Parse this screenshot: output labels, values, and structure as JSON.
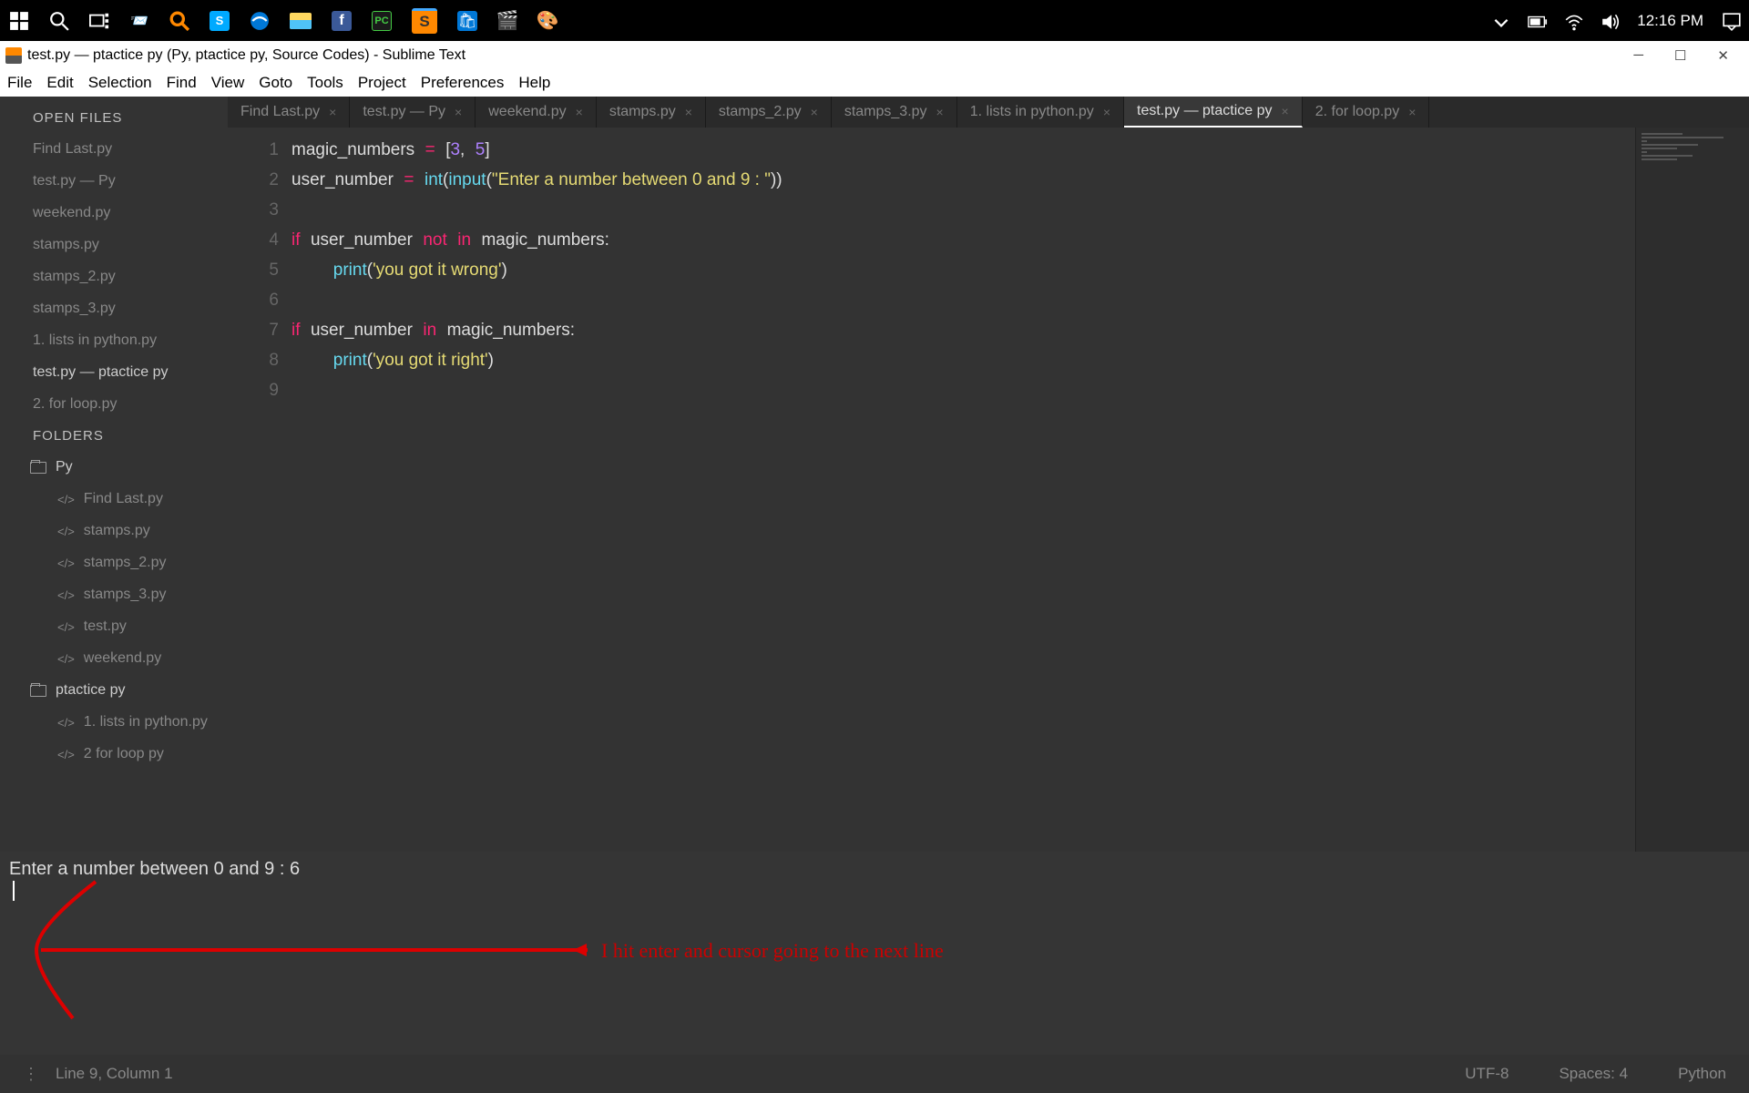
{
  "taskbar": {
    "time": "12:16 PM"
  },
  "titlebar": {
    "title": "test.py — ptactice py (Py, ptactice py, Source Codes) - Sublime Text"
  },
  "menubar": [
    "File",
    "Edit",
    "Selection",
    "Find",
    "View",
    "Goto",
    "Tools",
    "Project",
    "Preferences",
    "Help"
  ],
  "sidebar": {
    "open_files_label": "OPEN FILES",
    "open_files": [
      "Find Last.py",
      "test.py — Py",
      "weekend.py",
      "stamps.py",
      "stamps_2.py",
      "stamps_3.py",
      "1. lists in python.py",
      "test.py — ptactice py",
      "2. for loop.py"
    ],
    "folders_label": "FOLDERS",
    "folders": [
      {
        "name": "Py",
        "files": [
          "Find Last.py",
          "stamps.py",
          "stamps_2.py",
          "stamps_3.py",
          "test.py",
          "weekend.py"
        ]
      },
      {
        "name": "ptactice py",
        "files": [
          "1. lists in python.py",
          "2  for loop py"
        ]
      }
    ]
  },
  "tabs": [
    {
      "label": "Find Last.py",
      "active": false
    },
    {
      "label": "test.py — Py",
      "active": false
    },
    {
      "label": "weekend.py",
      "active": false
    },
    {
      "label": "stamps.py",
      "active": false
    },
    {
      "label": "stamps_2.py",
      "active": false
    },
    {
      "label": "stamps_3.py",
      "active": false
    },
    {
      "label": "1. lists in python.py",
      "active": false
    },
    {
      "label": "test.py — ptactice py",
      "active": true
    },
    {
      "label": "2. for loop.py",
      "active": false
    }
  ],
  "code": {
    "lines": [
      1,
      2,
      3,
      4,
      5,
      6,
      7,
      8,
      9
    ]
  },
  "console": {
    "line1": "Enter a number between 0 and 9 : 6",
    "annotation": "I hit enter and cursor going to the next line"
  },
  "statusbar": {
    "pos": "Line 9, Column 1",
    "encoding": "UTF-8",
    "spaces": "Spaces: 4",
    "lang": "Python"
  }
}
